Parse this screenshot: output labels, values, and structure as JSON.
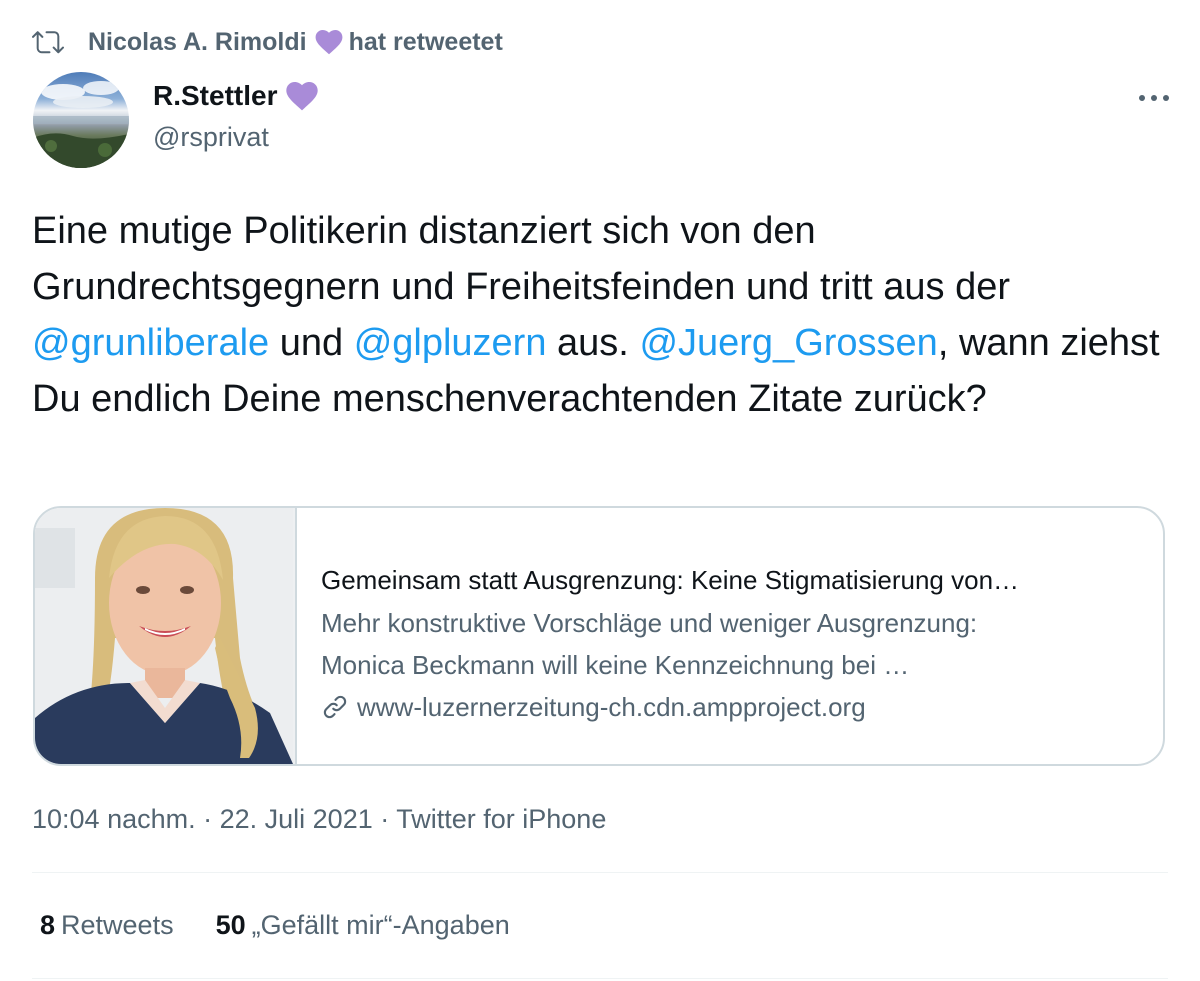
{
  "retweet": {
    "icon": "retweet-icon",
    "user": "Nicolas A. Rimoldi",
    "suffix": "hat retweetet",
    "badge_icon": "purple-heart-icon",
    "badge_color": "#a98bd8"
  },
  "author": {
    "name": "R.Stettler",
    "handle": "@rsprivat",
    "badge_icon": "purple-heart-icon"
  },
  "more_icon": "more-options-icon",
  "tweet": {
    "part1": "Eine mutige Politikerin distanziert sich von den Grundrechtsgegnern und Freiheitsfeinden und tritt aus der ",
    "mention1": "@grunliberale",
    "part2": " und ",
    "mention2": "@glpluzern",
    "part3": " aus. ",
    "mention3": "@Juerg_Grossen",
    "part4": ", wann ziehst Du endlich Deine menschenverachtenden Zitate zurück?"
  },
  "card": {
    "title": "Gemeinsam statt Ausgrenzung: Keine Stigmatisierung von…",
    "description_line1": "Mehr konstruktive Vorschläge und weniger Ausgrenzung:",
    "description_line2": "Monica Beckmann will keine Kennzeichnung bei …",
    "url": "www-luzernerzeitung-ch.cdn.ampproject.org",
    "url_icon": "link-icon"
  },
  "meta": {
    "time": "10:04 nachm.",
    "sep1": " · ",
    "date": "22. Juli 2021",
    "sep2": " · ",
    "source": "Twitter for iPhone"
  },
  "stats": {
    "retweets_count": "8",
    "retweets_label": "Retweets",
    "likes_count": "50",
    "likes_label": "„Gefällt mir“-Angaben"
  },
  "colors": {
    "link": "#1d9bf0",
    "secondary_text": "#536471",
    "primary_text": "#0f1419",
    "border": "#cfd9de"
  }
}
